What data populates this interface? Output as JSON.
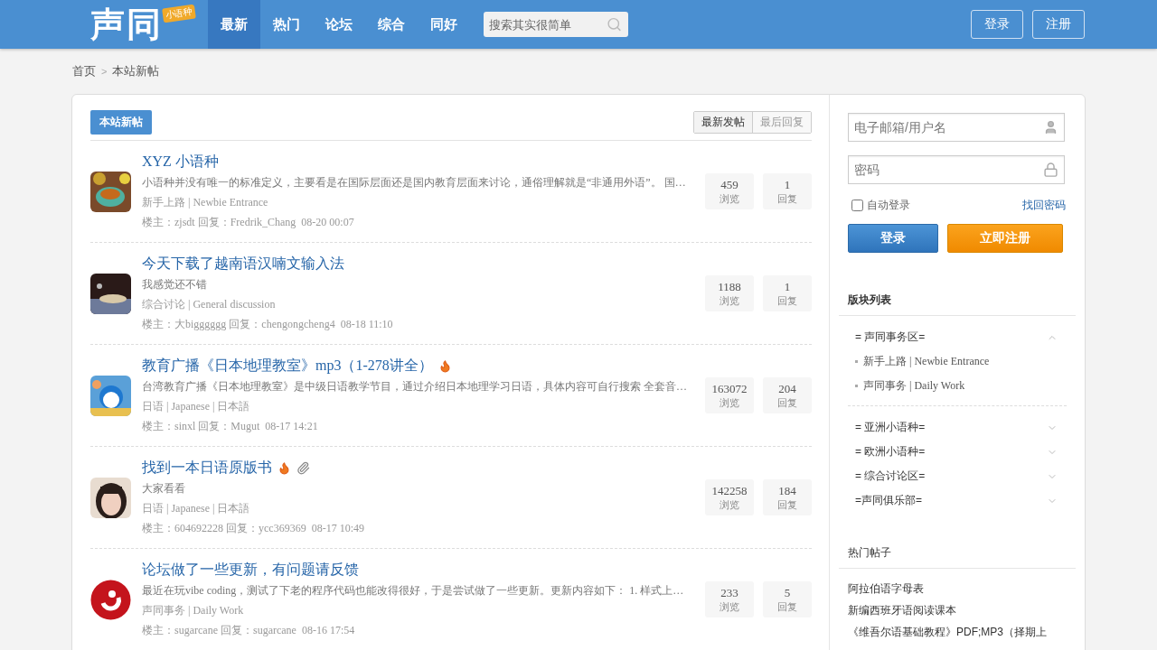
{
  "header": {
    "logo": {
      "text": "声同",
      "badge": "小语种"
    },
    "nav": [
      {
        "label": "最新",
        "selected": true
      },
      {
        "label": "热门",
        "selected": false
      },
      {
        "label": "论坛",
        "selected": false
      },
      {
        "label": "综合",
        "selected": false
      },
      {
        "label": "同好",
        "selected": false
      }
    ],
    "search": {
      "placeholder": "搜索其实很简单"
    },
    "buttons": [
      "登录",
      "注册"
    ]
  },
  "breadcrumb": [
    "首页",
    "本站新帖"
  ],
  "breadcrumb_separator": ">",
  "main": {
    "heading": "本站新帖",
    "tabs": [
      {
        "label": "最新发帖",
        "selected": true
      },
      {
        "label": "最后回复",
        "selected": false
      }
    ],
    "posts": [
      {
        "title": "XYZ 小语种",
        "hot": false,
        "attachment": false,
        "excerpt": "小语种并没有唯一的标准定义，主要看是在国际层面还是国内教育层面来讨论，通俗理解就是“非通用外语”。 国…",
        "forum": "新手上路 | Newbie Entrance",
        "byline": "楼主：zjsdt 回复：Fredrik_Chang",
        "time": "08-20 00:07",
        "views": "459",
        "views_label": "浏览",
        "replies": "1",
        "replies_label": "回复"
      },
      {
        "title": "今天下载了越南语汉喃文输入法",
        "hot": false,
        "attachment": false,
        "excerpt": "我感觉还不错",
        "forum": "综合讨论 | General discussion",
        "byline": "楼主：大bigggggg 回复：chengongcheng4",
        "time": "08-18 11:10",
        "views": "1188",
        "views_label": "浏览",
        "replies": "1",
        "replies_label": "回复"
      },
      {
        "title": "教育广播《日本地理教室》mp3（1-278讲全）",
        "hot": true,
        "attachment": false,
        "excerpt": "台湾教育广播《日本地理教室》是中级日语教学节目，通过介绍日本地理学习日语，具体内容可自行搜索 全套音…",
        "forum": "日语 | Japanese | 日本語",
        "byline": "楼主：sinxl 回复：Mugut",
        "time": "08-17 14:21",
        "views": "163072",
        "views_label": "浏览",
        "replies": "204",
        "replies_label": "回复"
      },
      {
        "title": "找到一本日语原版书",
        "hot": true,
        "attachment": true,
        "excerpt": "大家看看",
        "forum": "日语 | Japanese | 日本語",
        "byline": "楼主：604692228 回复：ycc369369",
        "time": "08-17 10:49",
        "views": "142258",
        "views_label": "浏览",
        "replies": "184",
        "replies_label": "回复"
      },
      {
        "title": "论坛做了一些更新，有问题请反馈",
        "hot": false,
        "attachment": false,
        "excerpt": "最近在玩vibe coding，测试了下老的程序代码也能改得很好，于是尝试做了一些更新。更新内容如下： 1. 样式上…",
        "forum": "声同事务 | Daily Work",
        "byline": "楼主：sugarcane 回复：sugarcane",
        "time": "08-16 17:54",
        "views": "233",
        "views_label": "浏览",
        "replies": "5",
        "replies_label": "回复"
      }
    ]
  },
  "sidebar": {
    "login": {
      "username": {
        "placeholder": "电子邮箱/用户名"
      },
      "password": {
        "placeholder": "密码"
      },
      "remember": {
        "label": "自动登录",
        "checked": false
      },
      "forgot": "找回密码",
      "login_button": "登录",
      "register_button": "立即注册"
    },
    "forums": {
      "title": "版块列表",
      "groups": [
        {
          "label": "= 声同事务区=",
          "expanded": true,
          "children": [
            {
              "label": "新手上路 | Newbie Entrance"
            },
            {
              "label": "声同事务 | Daily Work"
            }
          ]
        },
        {
          "label": "= 亚洲小语种=",
          "expanded": false
        },
        {
          "label": "= 欧洲小语种=",
          "expanded": false
        },
        {
          "label": "= 综合讨论区=",
          "expanded": false
        },
        {
          "label": "=声同俱乐部=",
          "expanded": false
        }
      ]
    },
    "hot": {
      "title": "热门帖子",
      "items": [
        "阿拉伯语字母表",
        "新编西班牙语阅读课本",
        "《维吾尔语基础教程》PDF;MP3（择期上"
      ]
    }
  }
}
